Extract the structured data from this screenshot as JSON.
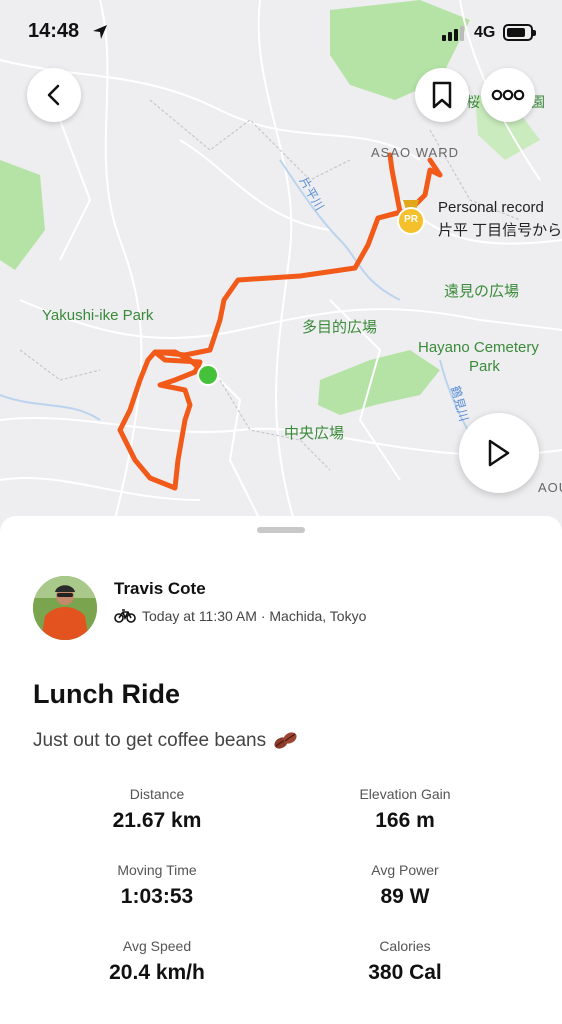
{
  "status_bar": {
    "time": "14:48",
    "network": "4G"
  },
  "map": {
    "labels": {
      "asao_ward": "ASAO WARD",
      "personal_record": "Personal record",
      "pr_segment": "片平 丁目信号から",
      "pr_badge": "PR",
      "yakushi_ike": "Yakushi-ike Park",
      "tomi_hiroba": "遠見の広場",
      "tamokuteki_hiroba": "多目的広場",
      "hayano_cemetery_line1": "Hayano Cemetery",
      "hayano_cemetery_line2": "Park",
      "chuo_hiroba": "中央広場",
      "river_katahira": "片平川",
      "river_tsurumi": "鶴見川",
      "corner_en": "園",
      "corner_sakura": "桜",
      "edge_aou": "AOU"
    },
    "route_color": "#f25a1a",
    "start_color": "#46c23a"
  },
  "activity": {
    "athlete_name": "Travis Cote",
    "activity_icon": "bike-icon",
    "meta": "Today at 11:30 AM · Machida, Tokyo",
    "title": "Lunch Ride",
    "description": "Just out to get coffee beans",
    "description_emoji": "coffee-bean-icon"
  },
  "stats": [
    {
      "label": "Distance",
      "value": "21.67 km"
    },
    {
      "label": "Elevation Gain",
      "value": "166 m"
    },
    {
      "label": "Moving Time",
      "value": "1:03:53"
    },
    {
      "label": "Avg Power",
      "value": "89 W"
    },
    {
      "label": "Avg Speed",
      "value": "20.4 km/h"
    },
    {
      "label": "Calories",
      "value": "380 Cal"
    }
  ]
}
